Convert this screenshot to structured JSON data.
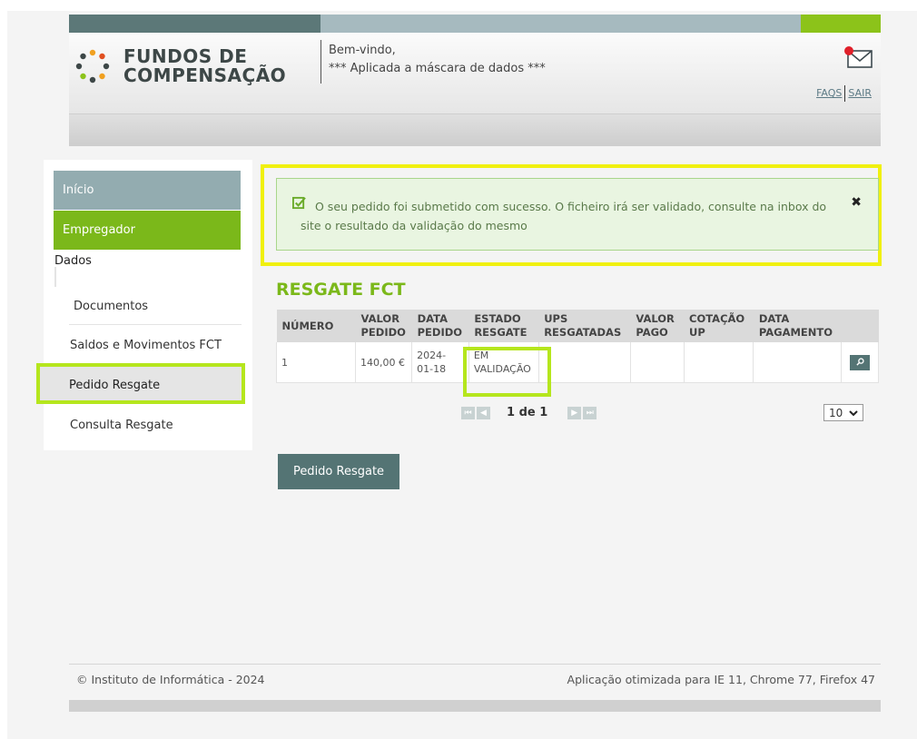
{
  "brand": {
    "logo_line1": "FUNDOS DE",
    "logo_line2": "COMPENSAÇÃO",
    "colors": {
      "accent_green": "#7bb81a",
      "dark_teal": "#5c7878",
      "highlight_yellow": "#f0f00e",
      "highlight_lime": "#b5e61d"
    }
  },
  "header": {
    "welcome": "Bem-vindo,",
    "user_masked": "*** Aplicada a máscara de dados ***",
    "mail_icon": "envelope-icon",
    "links": {
      "faqs": "FAQS",
      "sair": "SAIR"
    }
  },
  "sidebar": {
    "inicio": "Início",
    "empregador": "Empregador",
    "dados": "Dados",
    "documentos": "Documentos",
    "saldos": "Saldos e Movimentos FCT",
    "pedido_resgate": "Pedido Resgate",
    "consulta_resgate": "Consulta Resgate"
  },
  "alert": {
    "icon": "checkbox-check-icon",
    "message": "O seu pedido foi submetido com sucesso. O ficheiro irá ser validado, consulte na inbox do site o resultado da validação do mesmo",
    "close": "✖"
  },
  "section": {
    "title": "RESGATE FCT"
  },
  "table": {
    "headers": {
      "numero": "NÚMERO",
      "valor_pedido_1": "VALOR",
      "valor_pedido_2": "PEDIDO",
      "data_pedido_1": "DATA",
      "data_pedido_2": "PEDIDO",
      "estado_1": "ESTADO",
      "estado_2": "RESGATE",
      "ups_1": "UPS",
      "ups_2": "RESGATADAS",
      "valor_pago_1": "VALOR",
      "valor_pago_2": "PAGO",
      "cotacao_1": "COTAÇÃO",
      "cotacao_2": "UP",
      "data_pag_1": "DATA",
      "data_pag_2": "PAGAMENTO"
    },
    "rows": [
      {
        "numero": "1",
        "valor_pedido": "140,00 €",
        "data_pedido_1": "2024-",
        "data_pedido_2": "01-18",
        "estado_1": "EM",
        "estado_2": "VALIDAÇÃO",
        "ups_resgatadas": "",
        "valor_pago": "",
        "cotacao_up": "",
        "data_pagamento": ""
      }
    ]
  },
  "pagination": {
    "first": "⏮",
    "prev": "◀",
    "next": "▶",
    "last": "⏭",
    "info": "1 de 1",
    "page_size": "10"
  },
  "actions": {
    "pedido_resgate_button": "Pedido Resgate"
  },
  "footer": {
    "copyright": "© Instituto de Informática - 2024",
    "browsers": "Aplicação otimizada para IE 11, Chrome 77, Firefox 47"
  }
}
